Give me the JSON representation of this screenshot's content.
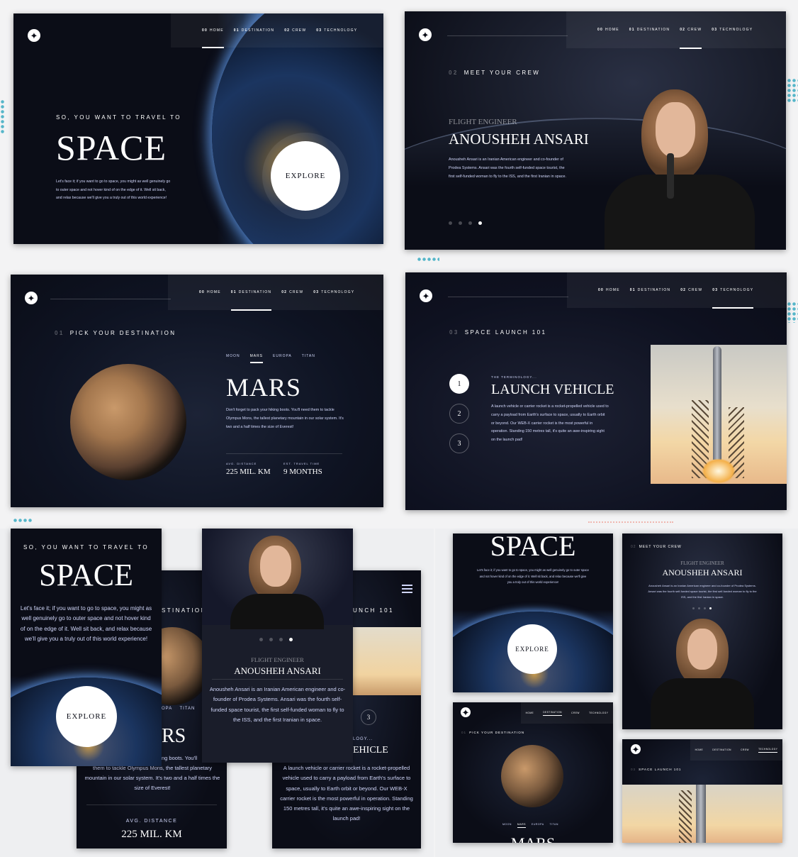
{
  "nav": {
    "items": [
      {
        "num": "00",
        "label": "HOME"
      },
      {
        "num": "01",
        "label": "DESTINATION"
      },
      {
        "num": "02",
        "label": "CREW"
      },
      {
        "num": "03",
        "label": "TECHNOLOGY"
      }
    ]
  },
  "home": {
    "eyebrow": "SO, YOU WANT TO TRAVEL TO",
    "title": "SPACE",
    "body": "Let's face it; if you want to go to space, you might as well genuinely go to outer space and not hover kind of on the edge of it. Well sit back, and relax because we'll give you a truly out of this world experience!",
    "explore": "EXPLORE"
  },
  "crew": {
    "num": "02",
    "heading": "MEET YOUR CREW",
    "role": "FLIGHT ENGINEER",
    "name": "ANOUSHEH ANSARI",
    "body": "Anousheh Ansari is an Iranian American engineer and co-founder of Prodea Systems. Ansari was the fourth self-funded space tourist, the first self-funded woman to fly to the ISS, and the first Iranian in space."
  },
  "destination": {
    "num": "01",
    "heading": "PICK YOUR DESTINATION",
    "tabs": [
      "MOON",
      "MARS",
      "EUROPA",
      "TITAN"
    ],
    "name": "MARS",
    "body": "Don't forget to pack your hiking boots. You'll need them to tackle Olympus Mons, the tallest planetary mountain in our solar system. It's two and a half times the size of Everest!",
    "distance_label": "AVG. DISTANCE",
    "distance": "225 MIL. KM",
    "travel_label": "EST. TRAVEL TIME",
    "travel": "9 MONTHS"
  },
  "technology": {
    "num": "03",
    "heading": "SPACE LAUNCH 101",
    "steps": [
      "1",
      "2",
      "3"
    ],
    "terminology": "THE TERMINOLOGY...",
    "name": "LAUNCH VEHICLE",
    "body": "A launch vehicle or carrier rocket is a rocket-propelled vehicle used to carry a payload from Earth's surface to space, usually to Earth orbit or beyond. Our WEB-X carrier rocket is the most powerful in operation. Standing 150 metres tall, it's quite an awe-inspiring sight on the launch pad!"
  },
  "mobile": {
    "destination_heading": "STINATION",
    "tech_heading": "UNCH 101",
    "mars_partial": "RS",
    "mars_body_partial": "ng boots. You'll",
    "mars_body_rest": "them to tackle Olympus Mons, the tallest planetary mountain in our solar system. It's two and a half times the size of Everest!",
    "titan_partial": "OPA    TITAN",
    "tech_term_partial": "LOGY...",
    "tech_name_partial": "EHICLE",
    "step3": "3",
    "home_body": "Let's face it; if you want to go to space, you might as well genuinely go to outer space and not hover kind of on the edge of it. Well sit back, and relax because we'll give you a truly out of this world experience!",
    "mars_name_partial": "MARS"
  },
  "colors": {
    "bg": "#0b0d17",
    "text": "#d0d6f9",
    "accent_dots": "#56b6c9",
    "zigzag": "#f0b7b0"
  }
}
